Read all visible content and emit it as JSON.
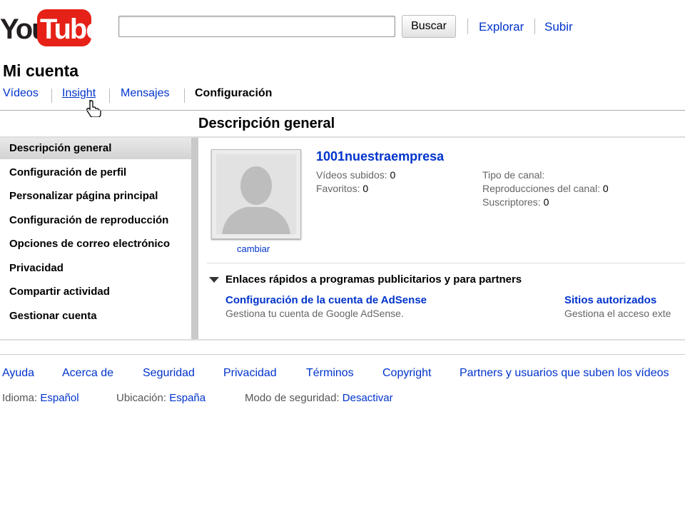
{
  "header": {
    "logo_you": "You",
    "logo_tube": "Tube",
    "search": {
      "value": "",
      "placeholder": ""
    },
    "search_button": "Buscar",
    "links": [
      "Explorar",
      "Subir"
    ]
  },
  "account": {
    "title": "Mi cuenta",
    "tabs": [
      "Vídeos",
      "Insight",
      "Mensajes",
      "Configuración"
    ],
    "active_tab": "Configuración"
  },
  "section_title": "Descripción general",
  "sidebar": {
    "items": [
      "Descripción general",
      "Configuración de perfil",
      "Personalizar página principal",
      "Configuración de reproducción",
      "Opciones de correo electrónico",
      "Privacidad",
      "Compartir actividad",
      "Gestionar cuenta"
    ],
    "active": "Descripción general"
  },
  "profile": {
    "channel_name": "1001nuestraempresa",
    "change_label": "cambiar",
    "stats_left": [
      {
        "label": "Vídeos subidos:",
        "value": "0"
      },
      {
        "label": "Favoritos:",
        "value": "0"
      }
    ],
    "stats_right": [
      {
        "label": "Tipo de canal:",
        "value": ""
      },
      {
        "label": "Reproducciones del canal:",
        "value": "0"
      },
      {
        "label": "Suscriptores:",
        "value": "0"
      }
    ]
  },
  "quick_links": {
    "title": "Enlaces rápidos a programas publicitarios y para partners",
    "items": [
      {
        "title": "Configuración de la cuenta de AdSense",
        "desc": "Gestiona tu cuenta de Google AdSense."
      },
      {
        "title": "Sitios autorizados",
        "desc": "Gestiona el acceso exte"
      }
    ]
  },
  "footer": {
    "links": [
      "Ayuda",
      "Acerca de",
      "Seguridad",
      "Privacidad",
      "Términos",
      "Copyright",
      "Partners y usuarios que suben los vídeos"
    ],
    "meta": [
      {
        "label": "Idioma:",
        "value": "Español"
      },
      {
        "label": "Ubicación:",
        "value": "España"
      },
      {
        "label": "Modo de seguridad:",
        "value": "Desactivar"
      }
    ]
  },
  "colors": {
    "link": "#0033cc",
    "logo_red": "#e62117"
  }
}
